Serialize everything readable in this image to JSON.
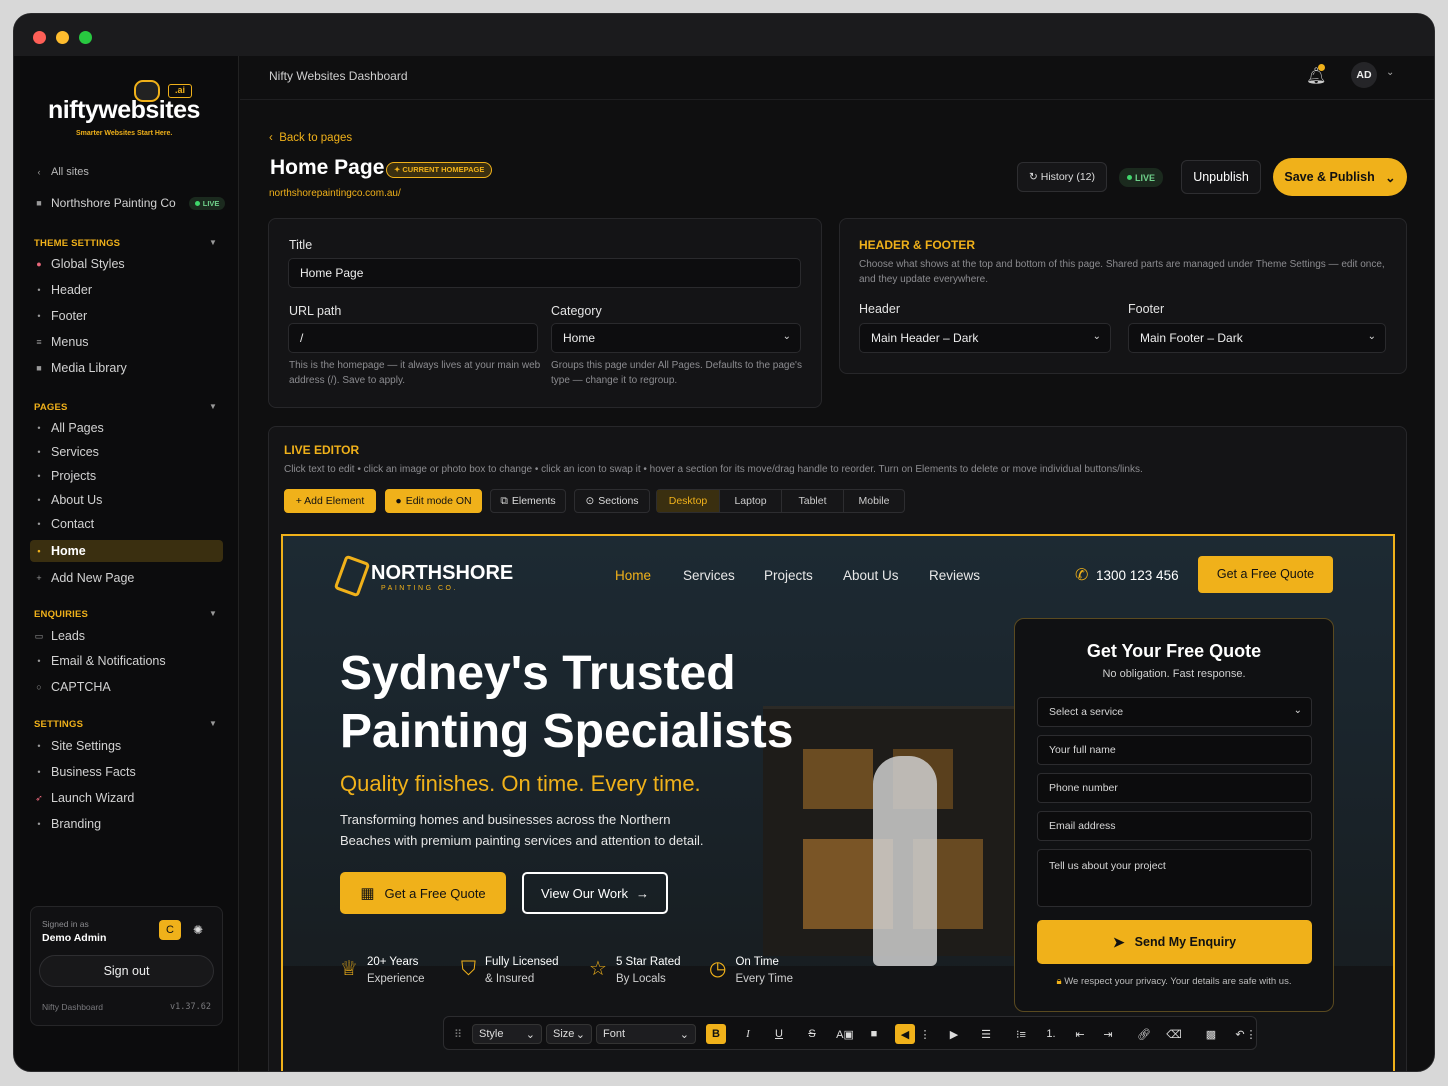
{
  "sidebar": {
    "logo_text": "niftywebsites",
    "logo_tag": "Smarter Websites Start Here.",
    "all_sites": "All sites",
    "site_name": "Northshore Painting Co",
    "site_status": "LIVE",
    "theme_settings": {
      "title": "THEME SETTINGS",
      "items": [
        "Global Styles",
        "Header",
        "Footer",
        "Menus",
        "Media Library"
      ]
    },
    "pages": {
      "title": "PAGES",
      "items": [
        "All Pages",
        "Services",
        "Projects",
        "About Us",
        "Contact",
        "Home"
      ],
      "add": "Add New Page"
    },
    "enquiries": {
      "title": "ENQUIRIES",
      "items": [
        "Leads",
        "Email & Notifications",
        "CAPTCHA"
      ]
    },
    "settings": {
      "title": "SETTINGS",
      "items": [
        "Site Settings",
        "Business Facts",
        "Launch Wizard",
        "Branding"
      ]
    },
    "signed_in_label": "Signed in as",
    "user_name": "Demo Admin",
    "user_initial": "C",
    "sign_out": "Sign out",
    "footer_name": "Nifty Dashboard",
    "version": "v1.37.62"
  },
  "topbar": {
    "title": "Nifty Websites Dashboard",
    "avatar": "AD"
  },
  "page": {
    "back": "Back to pages",
    "title": "Home Page",
    "badge": "CURRENT HOMEPAGE",
    "url": "northshorepaintingco.com.au/",
    "history": "History (12)",
    "status": "LIVE",
    "unpublish": "Unpublish",
    "save": "Save & Publish"
  },
  "form": {
    "title_label": "Title",
    "title_value": "Home Page",
    "url_label": "URL path",
    "url_value": "/",
    "url_help": "This is the homepage — it always lives at your main web address (/). Save to apply.",
    "category_label": "Category",
    "category_value": "Home",
    "category_help": "Groups this page under All Pages. Defaults to the page's type — change it to regroup."
  },
  "header_footer": {
    "title": "HEADER & FOOTER",
    "desc": "Choose what shows at the top and bottom of this page. Shared parts are managed under Theme Settings — edit once, and they update everywhere.",
    "header_label": "Header",
    "header_value": "Main Header – Dark",
    "footer_label": "Footer",
    "footer_value": "Main Footer – Dark"
  },
  "editor": {
    "title": "LIVE EDITOR",
    "desc": "Click text to edit • click an image or photo box to change • click an icon to swap it • hover a section for its move/drag handle to reorder. Turn on Elements to delete or move individual buttons/links.",
    "add_element": "+ Add Element",
    "edit_mode": "Edit mode ON",
    "elements": "Elements",
    "sections": "Sections",
    "devices": [
      "Desktop",
      "Laptop",
      "Tablet",
      "Mobile"
    ]
  },
  "preview": {
    "brand": "NORTHSHORE",
    "brand_sub": "PAINTING CO.",
    "nav": [
      "Home",
      "Services",
      "Projects",
      "About Us",
      "Reviews"
    ],
    "phone": "1300 123 456",
    "nav_cta": "Get a Free Quote",
    "headline_1": "Sydney's Trusted",
    "headline_2": "Painting Specialists",
    "tagline": "Quality finishes. On time. Every time.",
    "body_1": "Transforming homes and businesses across the Northern",
    "body_2": "Beaches with premium painting services and attention to detail.",
    "cta_primary": "Get a Free Quote",
    "cta_secondary": "View Our Work",
    "features": [
      {
        "t": "20+ Years",
        "s": "Experience"
      },
      {
        "t": "Fully Licensed",
        "s": "& Insured"
      },
      {
        "t": "5 Star Rated",
        "s": "By Locals"
      },
      {
        "t": "On Time",
        "s": "Every Time"
      }
    ],
    "quote": {
      "title": "Get Your Free Quote",
      "sub": "No obligation. Fast response.",
      "service": "Select a service",
      "name": "Your full name",
      "phone": "Phone number",
      "email": "Email address",
      "project": "Tell us about your project",
      "send": "Send My Enquiry",
      "privacy": "We respect your privacy. Your details are safe with us."
    }
  },
  "rte": {
    "style": "Style",
    "size": "Size",
    "font": "Font",
    "bold": "B",
    "italic": "I",
    "underline": "U",
    "list_num": "1."
  },
  "colors": {
    "accent": "#f0b11a",
    "bg": "#0f0f10",
    "live": "#3fd66b"
  }
}
